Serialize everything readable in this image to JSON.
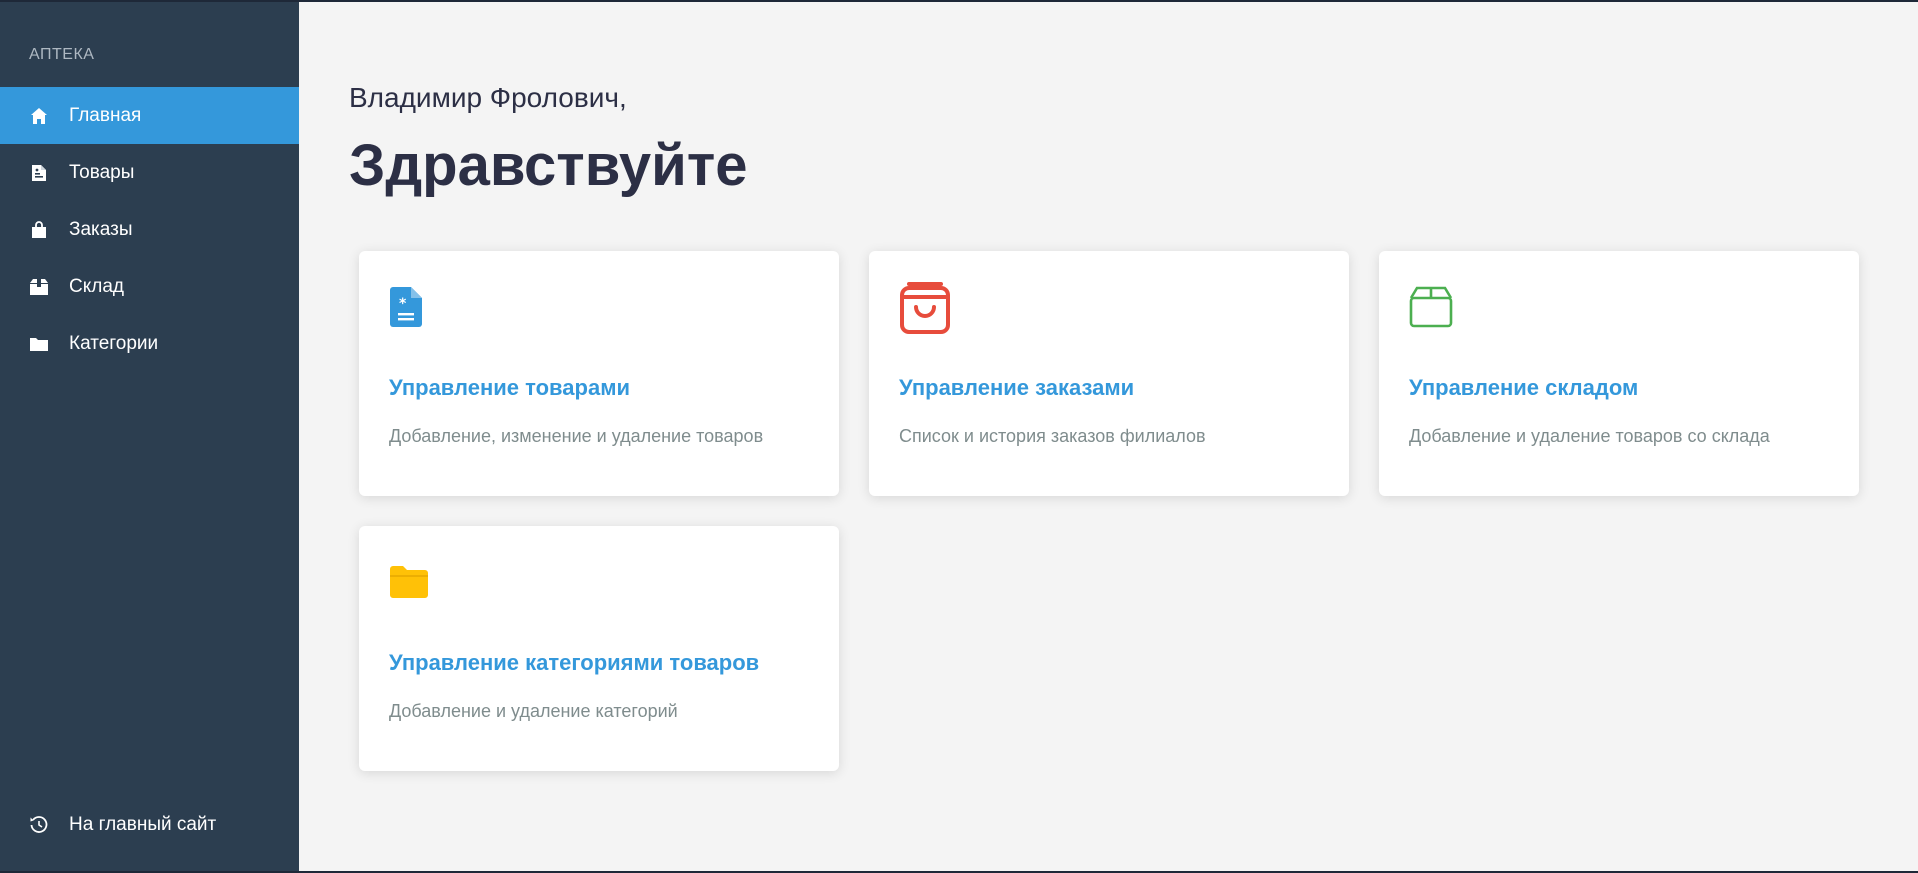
{
  "sidebar": {
    "brand": "АПТЕКА",
    "items": [
      {
        "label": "Главная",
        "icon": "home-icon",
        "active": true
      },
      {
        "label": "Товары",
        "icon": "document-icon",
        "active": false
      },
      {
        "label": "Заказы",
        "icon": "shopping-bag-icon",
        "active": false
      },
      {
        "label": "Склад",
        "icon": "box-icon",
        "active": false
      },
      {
        "label": "Категории",
        "icon": "folder-icon",
        "active": false
      }
    ],
    "bottom_link": {
      "label": "На главный сайт",
      "icon": "history-icon"
    }
  },
  "greeting": {
    "name": "Владимир Фролович,",
    "hello": "Здравствуйте"
  },
  "cards": [
    {
      "title": "Управление товарами",
      "description": "Добавление, изменение и удаление товаров",
      "icon": "medical-document-icon",
      "color": "#3498db"
    },
    {
      "title": "Управление заказами",
      "description": "Список и история заказов филиалов",
      "icon": "shopping-bag-icon",
      "color": "#e74c3c"
    },
    {
      "title": "Управление складом",
      "description": "Добавление и удаление товаров со склада",
      "icon": "box-icon",
      "color": "#4caf50"
    },
    {
      "title": "Управление категориями товаров",
      "description": "Добавление и удаление категорий",
      "icon": "folder-icon",
      "color": "#ffc107"
    }
  ],
  "colors": {
    "sidebar_bg": "#2c3e50",
    "accent": "#3498db",
    "text_dark": "#2c2f45",
    "text_muted": "#7f8c8d"
  }
}
